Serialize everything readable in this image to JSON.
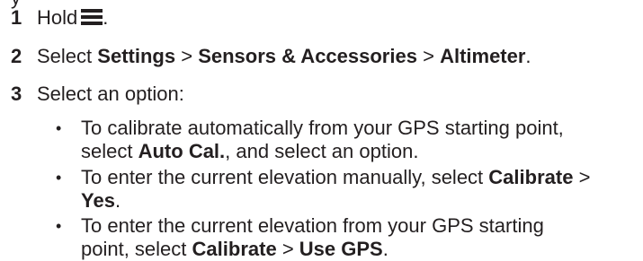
{
  "clipped_top_text": "y",
  "steps": [
    {
      "num": "1",
      "prefix": "Hold",
      "icon": "menu-icon",
      "suffix": "."
    },
    {
      "num": "2",
      "prefix": "Select",
      "settings": "Settings",
      "sep1": ">",
      "sensors": "Sensors & Accessories",
      "sep2": ">",
      "altimeter": "Altimeter",
      "suffix": "."
    },
    {
      "num": "3",
      "text": "Select an option:"
    }
  ],
  "bullets": [
    {
      "mark": "•",
      "line1": "To calibrate automatically from your GPS starting point,",
      "pre": "select",
      "bold": "Auto Cal.",
      "post": ", and select an option."
    },
    {
      "mark": "•",
      "pre": "To enter the current elevation manually, select",
      "bold1": "Calibrate",
      "sep": ">",
      "bold2": "Yes",
      "post": "."
    },
    {
      "mark": "•",
      "line1": "To enter the current elevation from your GPS starting",
      "pre": "point, select",
      "bold1": "Calibrate",
      "sep": ">",
      "bold2": "Use GPS",
      "post": "."
    }
  ]
}
